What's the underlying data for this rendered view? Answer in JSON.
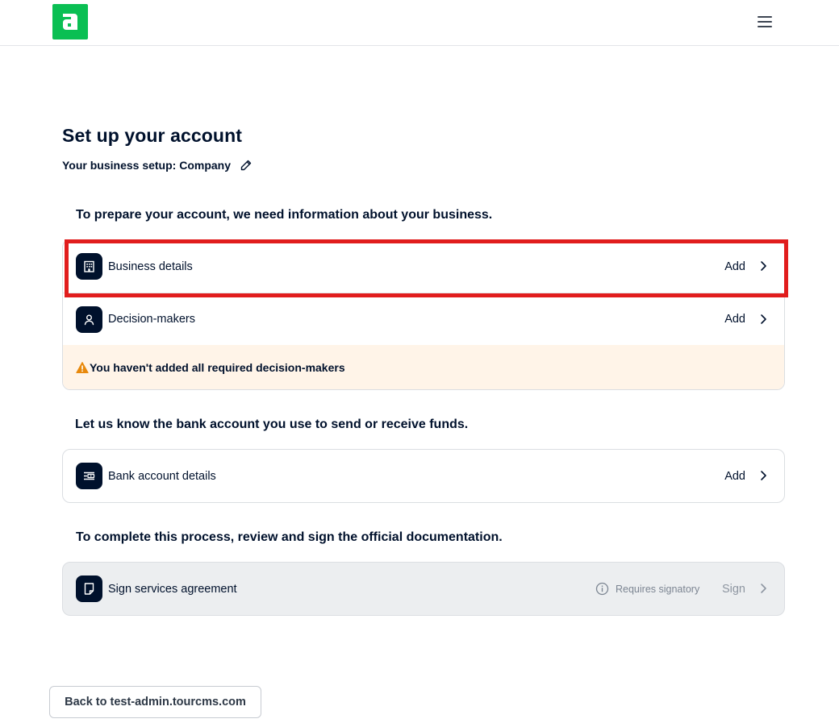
{
  "header": {
    "logo_letter": "a",
    "brand_color": "#0abf53",
    "menu_icon": "hamburger-menu-icon"
  },
  "page": {
    "title": "Set up your account",
    "setup_line": "Your business setup: Company",
    "edit_icon": "pencil-icon"
  },
  "sections": {
    "business": {
      "heading": "To prepare your account, we need information about your business.",
      "items": [
        {
          "label": "Business details",
          "action": "Add",
          "icon": "building-icon"
        },
        {
          "label": "Decision-makers",
          "action": "Add",
          "icon": "user-icon"
        }
      ],
      "warning": "You haven't added all required decision-makers",
      "warning_color": "#e8890c"
    },
    "bank": {
      "heading": "Let us know the bank account you use to send or receive funds.",
      "items": [
        {
          "label": "Bank account details",
          "action": "Add",
          "icon": "bank-card-icon"
        }
      ]
    },
    "documents": {
      "heading": "To complete this process, review and sign the official documentation.",
      "items": [
        {
          "label": "Sign services agreement",
          "note": "Requires signatory",
          "action": "Sign",
          "icon": "document-icon"
        }
      ]
    }
  },
  "footer": {
    "back_label": "Back to test-admin.tourcms.com"
  },
  "highlight_color": "#e11d1d"
}
